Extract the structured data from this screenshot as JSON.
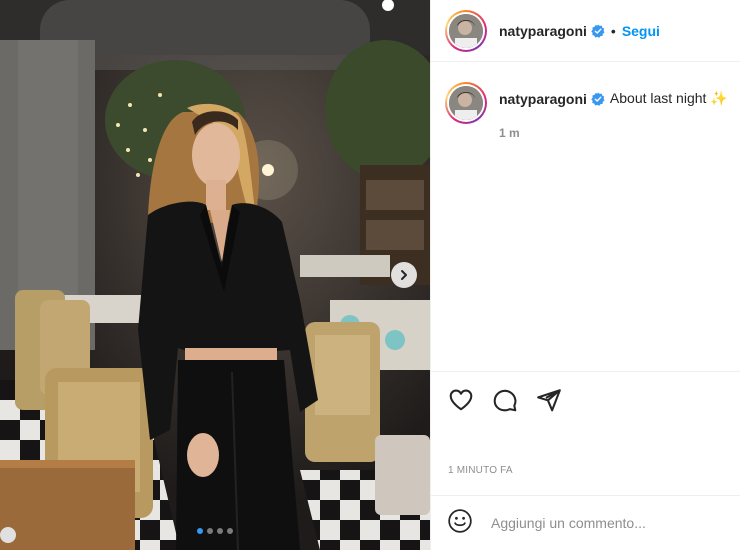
{
  "post": {
    "image_alt": "Woman in black blazer in a restaurant",
    "slides_total": 4,
    "slide_active": 1,
    "next_icon": "chevron-right-icon"
  },
  "header": {
    "username": "natyparagoni",
    "verified_icon": "verified-badge-icon",
    "separator": "•",
    "follow_label": "Segui"
  },
  "caption": {
    "username": "natyparagoni",
    "text": "About last night ✨",
    "time_short": "1 m"
  },
  "actions": {
    "like_icon": "heart-icon",
    "comment_icon": "comment-icon",
    "share_icon": "share-icon"
  },
  "timestamp": "1 MINUTO FA",
  "add_comment": {
    "emoji_icon": "emoji-icon",
    "placeholder": "Aggiungi un commento..."
  },
  "colors": {
    "accent": "#0095f6",
    "verified": "#3897f0",
    "text": "#262626",
    "muted": "#8e8e8e"
  }
}
